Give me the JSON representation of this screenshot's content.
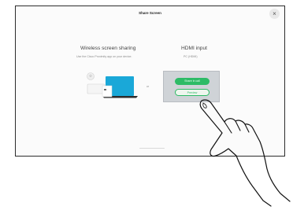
{
  "header": {
    "title": "Share Screen",
    "close_label": "×"
  },
  "wireless": {
    "title": "Wireless screen sharing",
    "subtitle": "Use the Cisco Proximity app on your device.",
    "or_label": "or"
  },
  "hdmi": {
    "title": "HDMI input",
    "subtitle": "PC (HDMI)",
    "share_button": "Share in call",
    "preview_button": "Preview"
  },
  "colors": {
    "accent": "#2dbb66",
    "laptop": "#1aa8d8",
    "panel": "#cfd3d7"
  },
  "icons": [
    "close-icon",
    "wifi-icon",
    "phone-icon",
    "laptop-icon",
    "hand-icon"
  ]
}
